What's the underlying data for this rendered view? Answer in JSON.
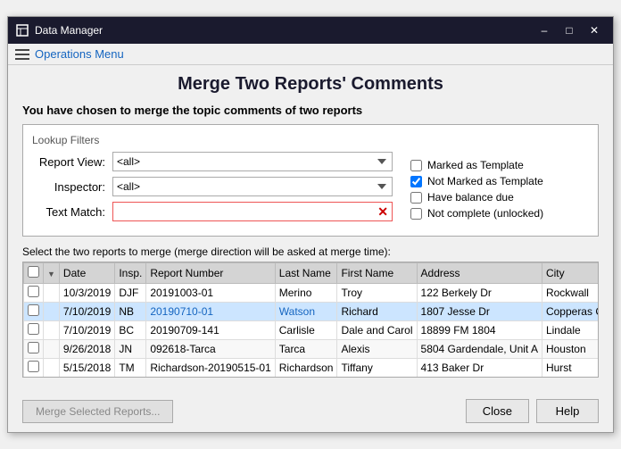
{
  "titleBar": {
    "icon": "📊",
    "title": "Data Manager",
    "minimizeLabel": "–",
    "maximizeLabel": "□",
    "closeLabel": "✕"
  },
  "menuBar": {
    "label": "Operations Menu"
  },
  "pageTitle": "Merge Two Reports' Comments",
  "infoText": "You have chosen to merge the topic comments of two reports",
  "filters": {
    "groupLabel": "Lookup Filters",
    "reportViewLabel": "Report View:",
    "reportViewValue": "<all>",
    "inspectorLabel": "Inspector:",
    "inspectorValue": "<all>",
    "textMatchLabel": "Text Match:",
    "textMatchValue": "",
    "textMatchPlaceholder": ""
  },
  "checkboxes": [
    {
      "label": "Marked as Template",
      "checked": false
    },
    {
      "label": "Not Marked as Template",
      "checked": true
    },
    {
      "label": "Have balance due",
      "checked": false
    },
    {
      "label": "Not complete (unlocked)",
      "checked": false
    }
  ],
  "tableDesc": "Select the two reports to merge (merge direction will be asked at merge time):",
  "tableHeaders": [
    "",
    "",
    "Date",
    "Insp.",
    "Report Number",
    "Last Name",
    "First Name",
    "Address",
    "City"
  ],
  "tableRows": [
    {
      "checked": false,
      "date": "10/3/2019",
      "insp": "DJF",
      "reportNum": "20191003-01",
      "lastName": "Merino",
      "firstName": "Troy",
      "address": "122 Berkely Dr",
      "city": "Rockwall",
      "highlight": false
    },
    {
      "checked": false,
      "date": "7/10/2019",
      "insp": "NB",
      "reportNum": "20190710-01",
      "lastName": "Watson",
      "firstName": "Richard",
      "address": "1807 Jesse Dr",
      "city": "Copperas Cover",
      "highlight": true
    },
    {
      "checked": false,
      "date": "7/10/2019",
      "insp": "BC",
      "reportNum": "20190709-141",
      "lastName": "Carlisle",
      "firstName": "Dale and Carol",
      "address": "18899 FM 1804",
      "city": "Lindale",
      "highlight": false
    },
    {
      "checked": false,
      "date": "9/26/2018",
      "insp": "JN",
      "reportNum": "092618-Tarca",
      "lastName": "Tarca",
      "firstName": "Alexis",
      "address": "5804 Gardendale, Unit A",
      "city": "Houston",
      "highlight": false
    },
    {
      "checked": false,
      "date": "5/15/2018",
      "insp": "TM",
      "reportNum": "Richardson-20190515-01",
      "lastName": "Richardson",
      "firstName": "Tiffany",
      "address": "413 Baker Dr",
      "city": "Hurst",
      "highlight": false
    }
  ],
  "mergeBtn": "Merge Selected Reports...",
  "closeBtn": "Close",
  "helpBtn": "Help"
}
